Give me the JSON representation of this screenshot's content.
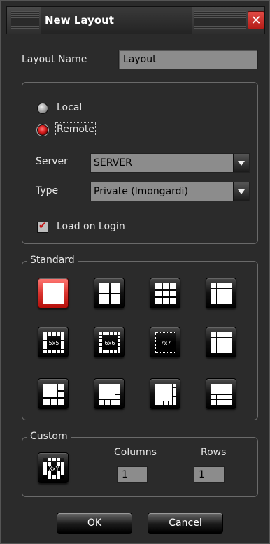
{
  "window": {
    "title": "New Layout",
    "close_label": "✕"
  },
  "layout_name": {
    "label": "Layout Name",
    "value": "Layout"
  },
  "location": {
    "local_label": "Local",
    "remote_label": "Remote",
    "selected": "Remote"
  },
  "server": {
    "label": "Server",
    "value": "SERVER"
  },
  "type": {
    "label": "Type",
    "value": "Private (lmongardi)"
  },
  "load_on_login": {
    "label": "Load on Login",
    "checked": true
  },
  "standard": {
    "title": "Standard",
    "tiles": [
      {
        "name": "1x1",
        "label": ""
      },
      {
        "name": "2x2",
        "label": ""
      },
      {
        "name": "3x3",
        "label": ""
      },
      {
        "name": "4x4",
        "label": ""
      },
      {
        "name": "5x5",
        "label": "5x5"
      },
      {
        "name": "6x6",
        "label": "6x6"
      },
      {
        "name": "7x7",
        "label": "7x7"
      },
      {
        "name": "1+8",
        "label": ""
      },
      {
        "name": "1+5",
        "label": ""
      },
      {
        "name": "1+7",
        "label": ""
      },
      {
        "name": "1+12",
        "label": ""
      },
      {
        "name": "2+8",
        "label": ""
      }
    ],
    "selected": "1x1"
  },
  "custom": {
    "title": "Custom",
    "tile_label": "XxY",
    "columns_label": "Columns",
    "columns_value": "1",
    "rows_label": "Rows",
    "rows_value": "1"
  },
  "buttons": {
    "ok": "OK",
    "cancel": "Cancel"
  },
  "colors": {
    "accent": "#d81d1d",
    "background": "#2b2b2b",
    "field": "#8c8c8c"
  }
}
